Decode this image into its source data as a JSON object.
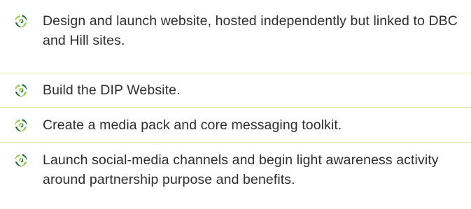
{
  "colors": {
    "divider": "#dfe7a2",
    "icon_light": "#8dc63f",
    "icon_dark": "#1b6b3a",
    "text": "#2e2e2e"
  },
  "bullet_icon": "swirl-leaf-icon",
  "items": [
    {
      "text": "Design and launch website, hosted independently but linked to DBC and Hill sites."
    },
    {
      "text": "Build the DIP Website."
    },
    {
      "text": "Create a media pack and core messaging toolkit."
    },
    {
      "text": "Launch social-media channels and begin light awareness activity around partnership purpose and benefits."
    }
  ]
}
